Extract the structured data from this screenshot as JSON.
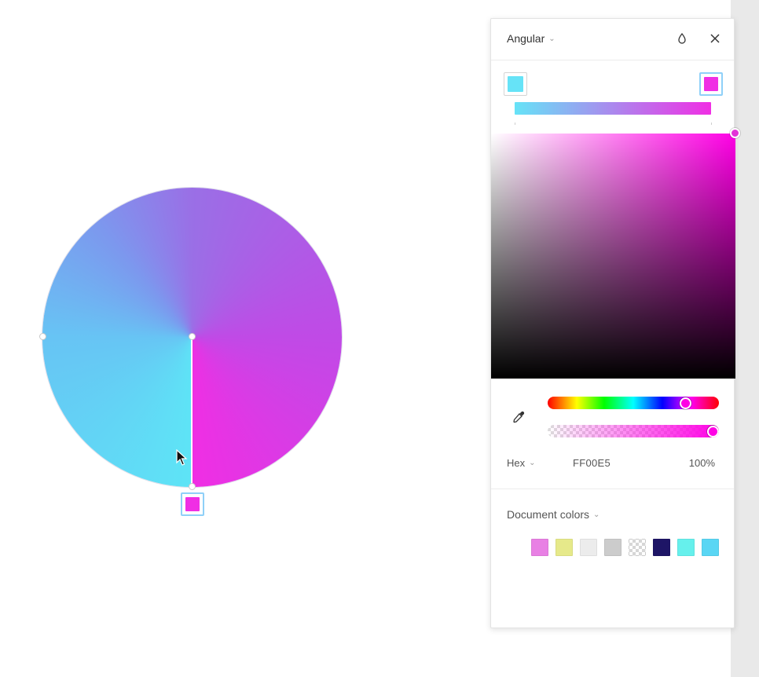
{
  "canvas": {
    "gradient_stops": [
      "#5ee4f6",
      "#f02ee4"
    ]
  },
  "picker": {
    "type_label": "Angular",
    "icons": {
      "style": "droplet-icon",
      "close": "close-icon",
      "eyedropper": "eyedropper-icon"
    },
    "stops": [
      {
        "color": "#66e3f7",
        "active": false
      },
      {
        "color": "#f02ee4",
        "active": true
      }
    ],
    "current_hex_color": "#ff00e5",
    "format_label": "Hex",
    "hex_value": "FF00E5",
    "opacity_value": "100%",
    "hue_fraction": 0.83,
    "alpha_fraction": 1.0,
    "document_colors_label": "Document colors",
    "document_colors": [
      "#e880e4",
      "#e6e98a",
      "#ececec",
      "#cccccc",
      "transparent",
      "#1e1566",
      "#66f0ec",
      "#5ad6f4"
    ]
  }
}
